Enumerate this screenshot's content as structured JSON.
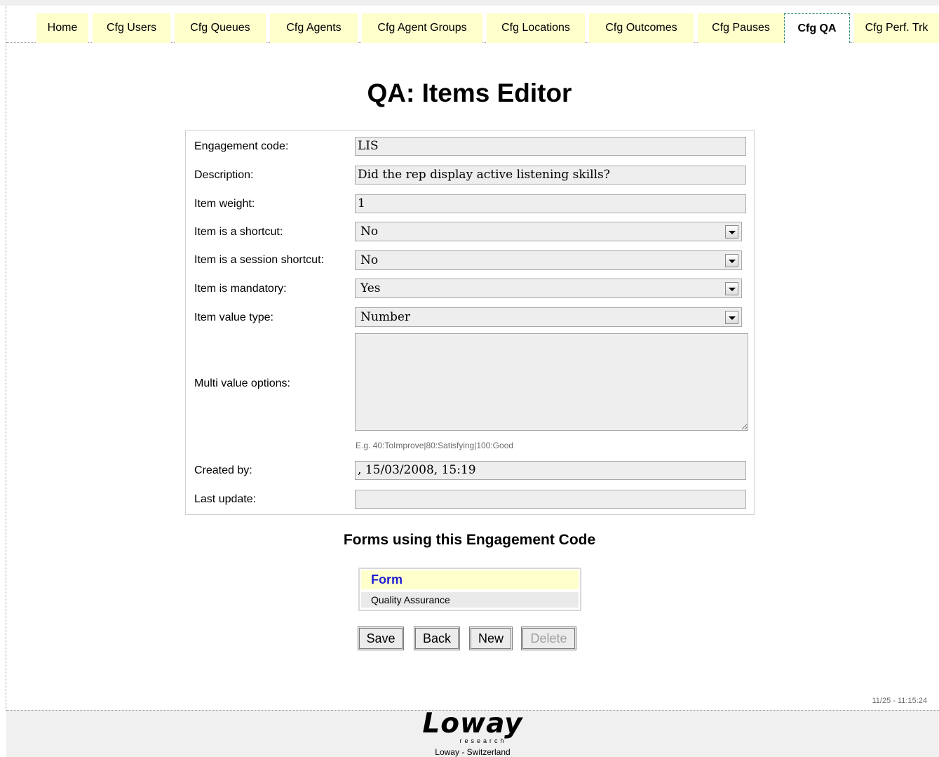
{
  "tabs": [
    {
      "label": "Home"
    },
    {
      "label": "Cfg Users"
    },
    {
      "label": "Cfg Queues"
    },
    {
      "label": "Cfg Agents"
    },
    {
      "label": "Cfg Agent Groups"
    },
    {
      "label": "Cfg Locations"
    },
    {
      "label": "Cfg Outcomes"
    },
    {
      "label": "Cfg Pauses"
    },
    {
      "label": "Cfg QA",
      "active": true
    },
    {
      "label": "Cfg Perf. Trk"
    }
  ],
  "page": {
    "title": "QA: Items Editor"
  },
  "form": {
    "engagement_code": {
      "label": "Engagement code:",
      "value": "LIS"
    },
    "description": {
      "label": "Description:",
      "value": "Did the rep display active listening skills?"
    },
    "item_weight": {
      "label": "Item weight:",
      "value": "1"
    },
    "is_shortcut": {
      "label": "Item is a shortcut:",
      "value": "No"
    },
    "is_session_shortcut": {
      "label": "Item is a session shortcut:",
      "value": "No"
    },
    "is_mandatory": {
      "label": "Item is mandatory:",
      "value": "Yes"
    },
    "value_type": {
      "label": "Item value type:",
      "value": "Number"
    },
    "multi_value_options": {
      "label": "Multi value options:",
      "value": "",
      "hint": "E.g. 40:ToImprove|80:Satisfying|100:Good"
    },
    "created_by": {
      "label": "Created by:",
      "value": ", 15/03/2008, 15:19"
    },
    "last_update": {
      "label": "Last update:",
      "value": ""
    }
  },
  "forms_section": {
    "title": "Forms using this Engagement Code",
    "column_header": "Form",
    "rows": [
      "Quality Assurance"
    ]
  },
  "buttons": {
    "save": "Save",
    "back": "Back",
    "new": "New",
    "delete": "Delete"
  },
  "timestamp": "11/25 - 11:15:24",
  "footer": {
    "logo_word": "Loway",
    "logo_sub": "research",
    "text": "Loway - Switzerland"
  }
}
